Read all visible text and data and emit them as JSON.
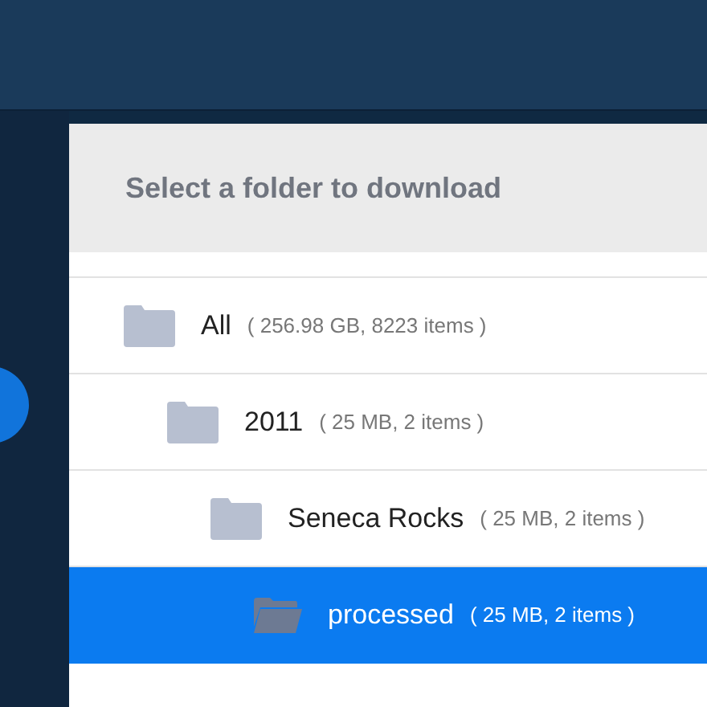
{
  "dialog": {
    "title": "Select a folder to download"
  },
  "folders": [
    {
      "name": "All",
      "info": "( 256.98 GB, 8223 items )",
      "selected": false,
      "children": [
        {
          "name": "2011",
          "info": "( 25 MB, 2 items )",
          "selected": false,
          "children": [
            {
              "name": "Seneca Rocks",
              "info": "( 25 MB, 2 items )",
              "selected": false,
              "children": [
                {
                  "name": "processed",
                  "info": "( 25 MB, 2 items )",
                  "selected": true
                }
              ]
            }
          ]
        }
      ]
    }
  ]
}
